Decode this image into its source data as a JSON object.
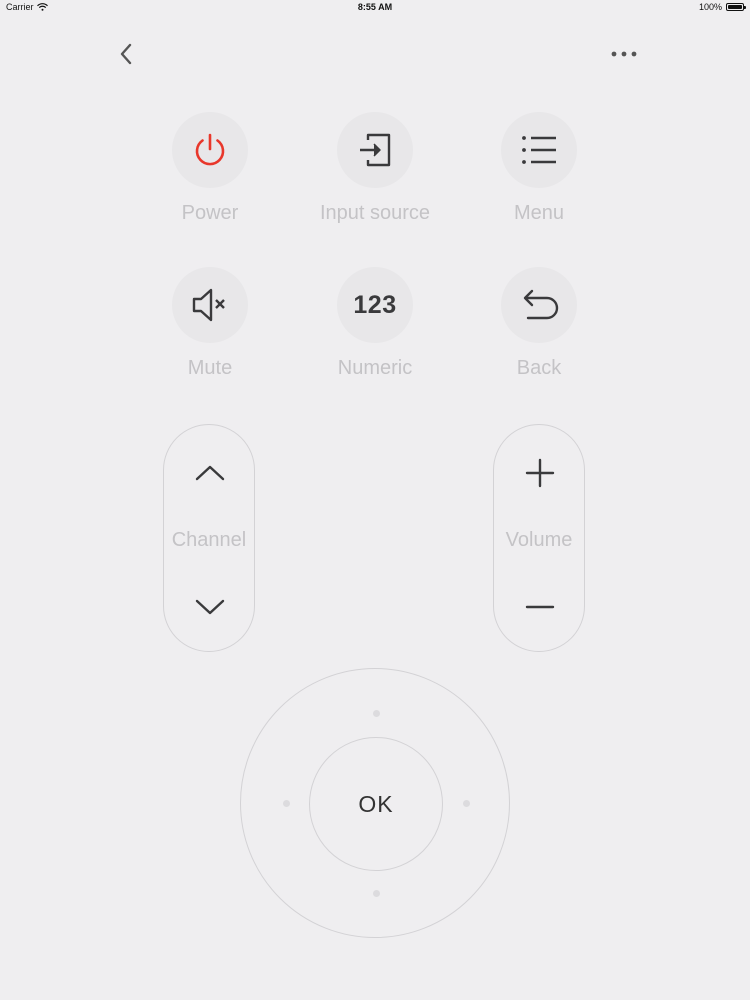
{
  "status_bar": {
    "carrier": "Carrier",
    "time": "8:55 AM",
    "battery": "100%"
  },
  "nav": {
    "back_icon": "chevron-left-icon",
    "more_icon": "more-horizontal-icon"
  },
  "buttons": {
    "power": {
      "label": "Power",
      "icon": "power-icon"
    },
    "input_source": {
      "label": "Input source",
      "icon": "input-source-icon"
    },
    "menu": {
      "label": "Menu",
      "icon": "list-icon"
    },
    "mute": {
      "label": "Mute",
      "icon": "speaker-mute-icon"
    },
    "numeric": {
      "label": "Numeric",
      "glyph": "123"
    },
    "back": {
      "label": "Back",
      "icon": "undo-arrow-icon"
    }
  },
  "channel": {
    "label": "Channel"
  },
  "volume": {
    "label": "Volume"
  },
  "dpad": {
    "ok_label": "OK"
  },
  "colors": {
    "background": "#efeef0",
    "button_fill": "#e8e7e9",
    "label": "#c4c3c6",
    "icon": "#3a3a3c",
    "power_accent": "#e8372b"
  }
}
